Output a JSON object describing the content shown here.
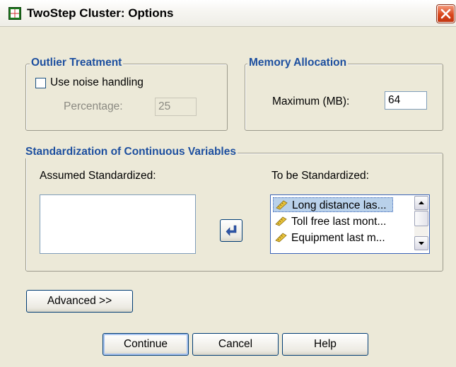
{
  "window": {
    "title": "TwoStep Cluster: Options"
  },
  "outlier": {
    "title": "Outlier Treatment",
    "noise_label": "Use noise handling",
    "noise_checked": false,
    "percentage_label": "Percentage:",
    "percentage_value": "25"
  },
  "memory": {
    "title": "Memory Allocation",
    "maximum_label": "Maximum (MB):",
    "maximum_value": "64"
  },
  "standardization": {
    "title": "Standardization of Continuous Variables",
    "assumed_label": "Assumed Standardized:",
    "assumed_items": [],
    "to_be_label": "To be Standardized:",
    "to_be_items": [
      {
        "label": "Long distance las...",
        "icon": "scale-ruler-icon",
        "selected": true
      },
      {
        "label": "Toll free last mont...",
        "icon": "scale-ruler-icon",
        "selected": false
      },
      {
        "label": "Equipment last m...",
        "icon": "scale-ruler-icon",
        "selected": false
      }
    ],
    "move_icon": "move-left-arrow-icon"
  },
  "buttons": {
    "advanced": "Advanced >>",
    "continue": "Continue",
    "cancel": "Cancel",
    "help": "Help"
  },
  "colors": {
    "group_title": "#1d4f9f",
    "background": "#ece9d8",
    "selection": "#b9d1ea",
    "close": "#d9471d"
  }
}
